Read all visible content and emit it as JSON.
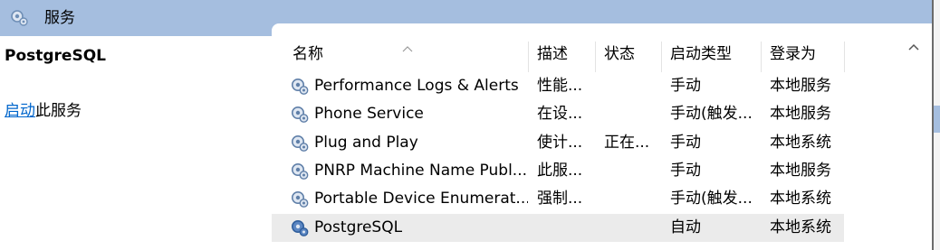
{
  "window": {
    "title": "服务"
  },
  "left_pane": {
    "service_name": "PostgreSQL",
    "action_link": "启动",
    "action_suffix": "此服务"
  },
  "columns": [
    {
      "key": "name",
      "label": "名称"
    },
    {
      "key": "desc",
      "label": "描述"
    },
    {
      "key": "status",
      "label": "状态"
    },
    {
      "key": "startup",
      "label": "启动类型"
    },
    {
      "key": "logon",
      "label": "登录为"
    }
  ],
  "rows": [
    {
      "name": "Performance Logs & Alerts",
      "desc": "性能...",
      "status": "",
      "startup": "手动",
      "logon": "本地服务",
      "selected": false
    },
    {
      "name": "Phone Service",
      "desc": "在设...",
      "status": "",
      "startup": "手动(触发...",
      "logon": "本地服务",
      "selected": false
    },
    {
      "name": "Plug and Play",
      "desc": "使计...",
      "status": "正在...",
      "startup": "手动",
      "logon": "本地系统",
      "selected": false
    },
    {
      "name": "PNRP Machine Name Publ...",
      "desc": "此服...",
      "status": "",
      "startup": "手动",
      "logon": "本地服务",
      "selected": false
    },
    {
      "name": "Portable Device Enumerat...",
      "desc": "强制...",
      "status": "",
      "startup": "手动(触发...",
      "logon": "本地系统",
      "selected": false
    },
    {
      "name": "PostgreSQL",
      "desc": "",
      "status": "",
      "startup": "自动",
      "logon": "本地系统",
      "selected": true
    }
  ],
  "icons": {
    "title": "gear-icon",
    "row": "service-gear-icon",
    "sort": "sort-up-caret-icon",
    "scroll_up": "scroll-up-arrow-icon"
  },
  "colors": {
    "title_band": "#a5bedf",
    "link": "#0066cc",
    "selected_row": "#ebebeb"
  }
}
